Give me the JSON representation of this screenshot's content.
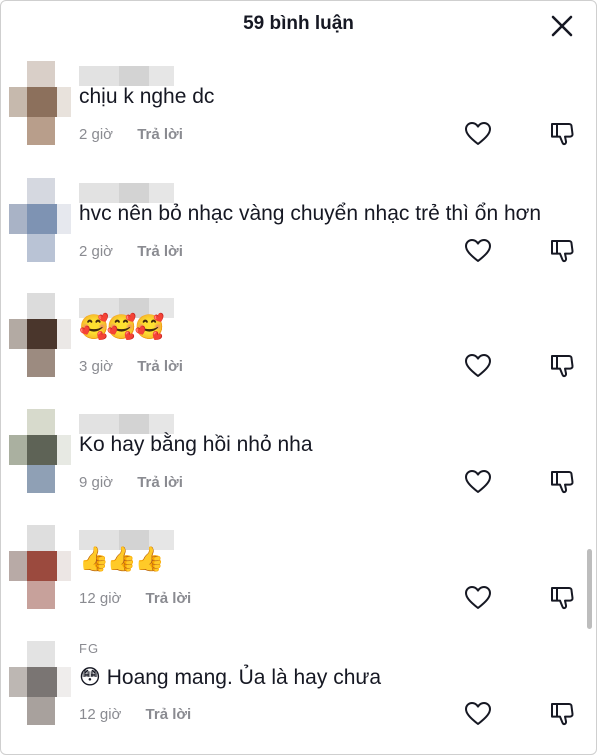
{
  "header": {
    "title": "59 bình luận",
    "close_icon": "close-icon"
  },
  "comments": [
    {
      "username": "",
      "text": "chịu k nghe dc",
      "time": "2 giờ",
      "reply": "Trả lời",
      "avatar_colors": [
        "#d9cfc8",
        "#c6b9ad",
        "#8c705c",
        "#e8e2dc",
        "#b89e8b"
      ]
    },
    {
      "username": "",
      "text": "hvc nên bỏ nhạc vàng chuyển nhạc trẻ thì ổn hơn",
      "time": "2 giờ",
      "reply": "Trả lời",
      "avatar_colors": [
        "#d5d8e0",
        "#a9b3c6",
        "#7e93b3",
        "#e6e8ee",
        "#b9c3d5"
      ]
    },
    {
      "username": "",
      "text": "🥰🥰🥰",
      "time": "3 giờ",
      "reply": "Trả lời",
      "avatar_colors": [
        "#dcdcdc",
        "#b3aaa3",
        "#4a362c",
        "#ebe8e6",
        "#9c8b80"
      ]
    },
    {
      "username": "",
      "text": "Ko hay bằng hồi nhỏ nha",
      "time": "9 giờ",
      "reply": "Trả lời",
      "avatar_colors": [
        "#d7dacc",
        "#aab0a0",
        "#5e6356",
        "#e7e9e3",
        "#8fa0b5"
      ]
    },
    {
      "username": "",
      "text": "👍👍👍",
      "time": "12 giờ",
      "reply": "Trả lời",
      "avatar_colors": [
        "#dedede",
        "#b8aaa6",
        "#9b4a3e",
        "#ece6e4",
        "#c7a19b"
      ]
    },
    {
      "username": "FG",
      "text": "😳 Hoang mang. Ủa là hay chưa",
      "time": "12 giờ",
      "reply": "Trả lời",
      "avatar_colors": [
        "#e3e3e3",
        "#bdb7b3",
        "#7a7573",
        "#efedec",
        "#a8a19d"
      ]
    }
  ],
  "colors": {
    "text": "#161823",
    "muted": "#8a8b91",
    "background": "#ffffff"
  }
}
